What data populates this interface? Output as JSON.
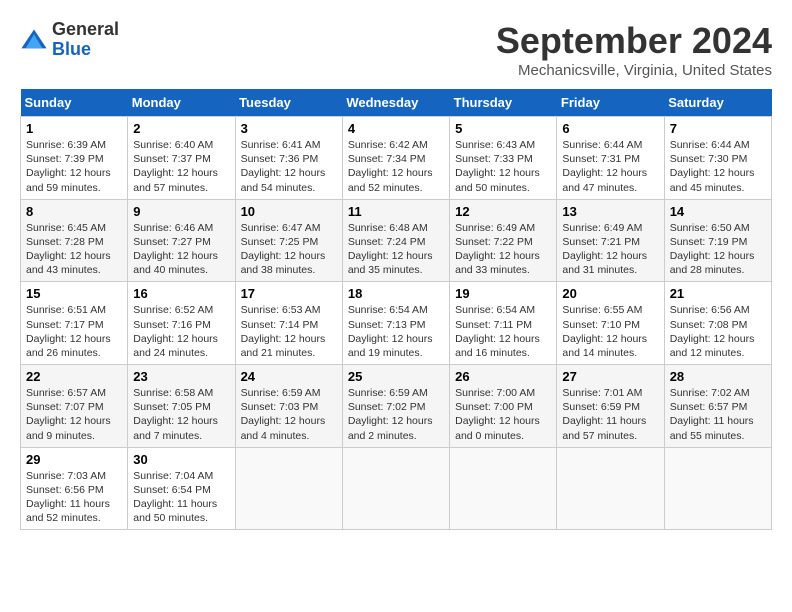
{
  "header": {
    "title": "September 2024",
    "location": "Mechanicsville, Virginia, United States",
    "logo_general": "General",
    "logo_blue": "Blue"
  },
  "columns": [
    "Sunday",
    "Monday",
    "Tuesday",
    "Wednesday",
    "Thursday",
    "Friday",
    "Saturday"
  ],
  "weeks": [
    [
      {
        "day": "1",
        "sunrise": "Sunrise: 6:39 AM",
        "sunset": "Sunset: 7:39 PM",
        "daylight": "Daylight: 12 hours and 59 minutes."
      },
      {
        "day": "2",
        "sunrise": "Sunrise: 6:40 AM",
        "sunset": "Sunset: 7:37 PM",
        "daylight": "Daylight: 12 hours and 57 minutes."
      },
      {
        "day": "3",
        "sunrise": "Sunrise: 6:41 AM",
        "sunset": "Sunset: 7:36 PM",
        "daylight": "Daylight: 12 hours and 54 minutes."
      },
      {
        "day": "4",
        "sunrise": "Sunrise: 6:42 AM",
        "sunset": "Sunset: 7:34 PM",
        "daylight": "Daylight: 12 hours and 52 minutes."
      },
      {
        "day": "5",
        "sunrise": "Sunrise: 6:43 AM",
        "sunset": "Sunset: 7:33 PM",
        "daylight": "Daylight: 12 hours and 50 minutes."
      },
      {
        "day": "6",
        "sunrise": "Sunrise: 6:44 AM",
        "sunset": "Sunset: 7:31 PM",
        "daylight": "Daylight: 12 hours and 47 minutes."
      },
      {
        "day": "7",
        "sunrise": "Sunrise: 6:44 AM",
        "sunset": "Sunset: 7:30 PM",
        "daylight": "Daylight: 12 hours and 45 minutes."
      }
    ],
    [
      {
        "day": "8",
        "sunrise": "Sunrise: 6:45 AM",
        "sunset": "Sunset: 7:28 PM",
        "daylight": "Daylight: 12 hours and 43 minutes."
      },
      {
        "day": "9",
        "sunrise": "Sunrise: 6:46 AM",
        "sunset": "Sunset: 7:27 PM",
        "daylight": "Daylight: 12 hours and 40 minutes."
      },
      {
        "day": "10",
        "sunrise": "Sunrise: 6:47 AM",
        "sunset": "Sunset: 7:25 PM",
        "daylight": "Daylight: 12 hours and 38 minutes."
      },
      {
        "day": "11",
        "sunrise": "Sunrise: 6:48 AM",
        "sunset": "Sunset: 7:24 PM",
        "daylight": "Daylight: 12 hours and 35 minutes."
      },
      {
        "day": "12",
        "sunrise": "Sunrise: 6:49 AM",
        "sunset": "Sunset: 7:22 PM",
        "daylight": "Daylight: 12 hours and 33 minutes."
      },
      {
        "day": "13",
        "sunrise": "Sunrise: 6:49 AM",
        "sunset": "Sunset: 7:21 PM",
        "daylight": "Daylight: 12 hours and 31 minutes."
      },
      {
        "day": "14",
        "sunrise": "Sunrise: 6:50 AM",
        "sunset": "Sunset: 7:19 PM",
        "daylight": "Daylight: 12 hours and 28 minutes."
      }
    ],
    [
      {
        "day": "15",
        "sunrise": "Sunrise: 6:51 AM",
        "sunset": "Sunset: 7:17 PM",
        "daylight": "Daylight: 12 hours and 26 minutes."
      },
      {
        "day": "16",
        "sunrise": "Sunrise: 6:52 AM",
        "sunset": "Sunset: 7:16 PM",
        "daylight": "Daylight: 12 hours and 24 minutes."
      },
      {
        "day": "17",
        "sunrise": "Sunrise: 6:53 AM",
        "sunset": "Sunset: 7:14 PM",
        "daylight": "Daylight: 12 hours and 21 minutes."
      },
      {
        "day": "18",
        "sunrise": "Sunrise: 6:54 AM",
        "sunset": "Sunset: 7:13 PM",
        "daylight": "Daylight: 12 hours and 19 minutes."
      },
      {
        "day": "19",
        "sunrise": "Sunrise: 6:54 AM",
        "sunset": "Sunset: 7:11 PM",
        "daylight": "Daylight: 12 hours and 16 minutes."
      },
      {
        "day": "20",
        "sunrise": "Sunrise: 6:55 AM",
        "sunset": "Sunset: 7:10 PM",
        "daylight": "Daylight: 12 hours and 14 minutes."
      },
      {
        "day": "21",
        "sunrise": "Sunrise: 6:56 AM",
        "sunset": "Sunset: 7:08 PM",
        "daylight": "Daylight: 12 hours and 12 minutes."
      }
    ],
    [
      {
        "day": "22",
        "sunrise": "Sunrise: 6:57 AM",
        "sunset": "Sunset: 7:07 PM",
        "daylight": "Daylight: 12 hours and 9 minutes."
      },
      {
        "day": "23",
        "sunrise": "Sunrise: 6:58 AM",
        "sunset": "Sunset: 7:05 PM",
        "daylight": "Daylight: 12 hours and 7 minutes."
      },
      {
        "day": "24",
        "sunrise": "Sunrise: 6:59 AM",
        "sunset": "Sunset: 7:03 PM",
        "daylight": "Daylight: 12 hours and 4 minutes."
      },
      {
        "day": "25",
        "sunrise": "Sunrise: 6:59 AM",
        "sunset": "Sunset: 7:02 PM",
        "daylight": "Daylight: 12 hours and 2 minutes."
      },
      {
        "day": "26",
        "sunrise": "Sunrise: 7:00 AM",
        "sunset": "Sunset: 7:00 PM",
        "daylight": "Daylight: 12 hours and 0 minutes."
      },
      {
        "day": "27",
        "sunrise": "Sunrise: 7:01 AM",
        "sunset": "Sunset: 6:59 PM",
        "daylight": "Daylight: 11 hours and 57 minutes."
      },
      {
        "day": "28",
        "sunrise": "Sunrise: 7:02 AM",
        "sunset": "Sunset: 6:57 PM",
        "daylight": "Daylight: 11 hours and 55 minutes."
      }
    ],
    [
      {
        "day": "29",
        "sunrise": "Sunrise: 7:03 AM",
        "sunset": "Sunset: 6:56 PM",
        "daylight": "Daylight: 11 hours and 52 minutes."
      },
      {
        "day": "30",
        "sunrise": "Sunrise: 7:04 AM",
        "sunset": "Sunset: 6:54 PM",
        "daylight": "Daylight: 11 hours and 50 minutes."
      },
      null,
      null,
      null,
      null,
      null
    ]
  ]
}
